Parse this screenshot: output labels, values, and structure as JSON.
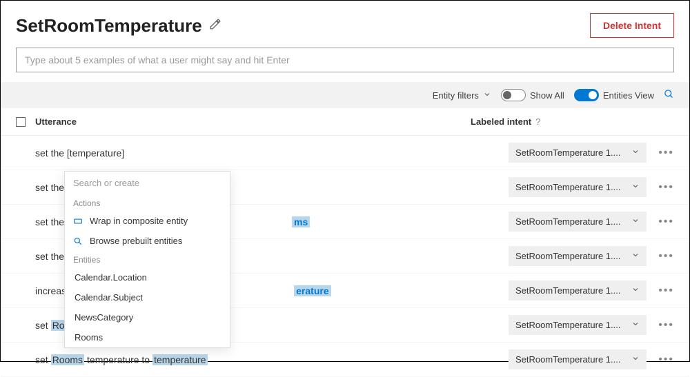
{
  "header": {
    "title": "SetRoomTemperature",
    "delete_label": "Delete Intent"
  },
  "input": {
    "placeholder": "Type about 5 examples of what a user might say and hit Enter"
  },
  "filter_bar": {
    "entity_filters": "Entity filters",
    "show_all": "Show All",
    "entities_view": "Entities View"
  },
  "columns": {
    "utterance": "Utterance",
    "labeled_intent": "Labeled intent",
    "help": "?"
  },
  "intent_pill": "SetRoomTemperature 1....",
  "rows": [
    {
      "pre": "set the [temperature]",
      "peek": ""
    },
    {
      "pre": "set the",
      "peek": ""
    },
    {
      "pre": "set the",
      "peek": "ms"
    },
    {
      "pre": "set the",
      "peek": ""
    },
    {
      "pre": "increas",
      "peek": "erature"
    },
    {
      "pre": "set",
      "hl1": "Roo",
      "peek": ""
    },
    {
      "pre": "set",
      "hl1": "Rooms",
      "mid": " temperature to ",
      "hl2": "temperature",
      "peek": ""
    }
  ],
  "popup": {
    "search_placeholder": "Search or create",
    "actions_label": "Actions",
    "wrap_label": "Wrap in composite entity",
    "browse_label": "Browse prebuilt entities",
    "entities_label": "Entities",
    "entities": [
      "Calendar.Location",
      "Calendar.Subject",
      "NewsCategory",
      "Rooms"
    ]
  }
}
